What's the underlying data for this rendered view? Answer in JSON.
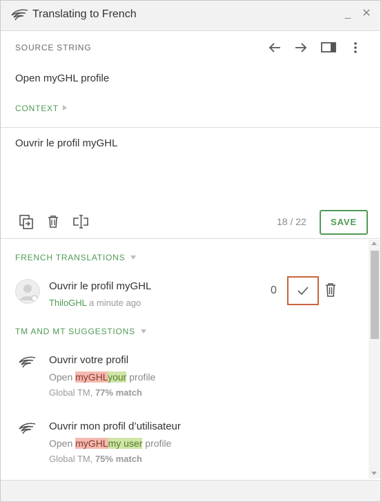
{
  "window": {
    "title": "Translating to French",
    "minimize_label": "_",
    "close_label": "✕",
    "logo_icon": "app-logo-icon"
  },
  "source": {
    "label": "SOURCE STRING",
    "text": "Open myGHL profile",
    "context_label": "CONTEXT",
    "toolbar_icons": [
      "arrow-left-icon",
      "arrow-right-icon",
      "toggle-panel-icon",
      "more-vertical-icon"
    ]
  },
  "editor": {
    "value": "Ouvrir le profil myGHL",
    "char_count": "18 / 22",
    "save_label": "SAVE",
    "action_icons": [
      "copy-source-icon",
      "clear-icon",
      "insert-text-icon"
    ]
  },
  "translations": {
    "heading": "FRENCH TRANSLATIONS",
    "items": [
      {
        "text": "Ouvrir le profil myGHL",
        "user": "ThiloGHL",
        "time": "a minute ago",
        "votes": "0"
      }
    ]
  },
  "suggestions": {
    "heading": "TM AND MT SUGGESTIONS",
    "items": [
      {
        "text": "Ouvrir votre profil",
        "diff_prefix": "Open ",
        "diff_removed": "myGHL",
        "diff_added": "your",
        "diff_suffix": " profile",
        "source": "Global TM, ",
        "match": "77% match"
      },
      {
        "text": "Ouvrir mon profil d’utilisateur",
        "diff_prefix": "Open ",
        "diff_removed": "myGHL",
        "diff_added": "my user",
        "diff_suffix": " profile",
        "source": "Global TM, ",
        "match": "75% match"
      }
    ]
  },
  "colors": {
    "accent_green": "#4f9a54",
    "approve_border": "#c8643c",
    "diff_removed_bg": "#f4b9b0",
    "diff_added_bg": "#cfe6a8"
  }
}
